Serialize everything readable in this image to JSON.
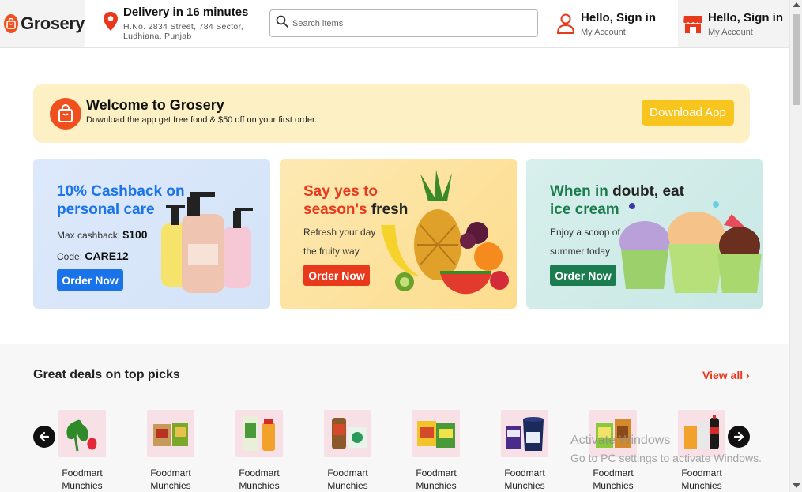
{
  "header": {
    "logo_text": "Grosery",
    "delivery_title": "Delivery in 16 minutes",
    "delivery_address": "H.No. 2834 Street, 784 Sector, Ludhiana, Punjab",
    "search_placeholder": "Search items",
    "account": {
      "title": "Hello, Sign in",
      "subtitle": "My Account"
    },
    "store_account": {
      "title": "Hello, Sign in",
      "subtitle": "My Account"
    }
  },
  "welcome": {
    "title": "Welcome to Grosery",
    "subtitle": "Download the app get free food & $50 off on your first order.",
    "button": "Download App"
  },
  "promos": [
    {
      "title_part1": "10% Cashback on",
      "title_part2": "personal care",
      "line1_label": "Max cashback: ",
      "line1_value": "$100",
      "line2_label": "Code: ",
      "line2_value": "CARE12",
      "button": "Order Now"
    },
    {
      "title_part1": "Say yes to",
      "title_part2": "season's",
      "title_part3": "fresh",
      "line1": "Refresh your day",
      "line2": "the fruity way",
      "button": "Order Now"
    },
    {
      "title_part1": "When in",
      "title_part2": "doubt, eat",
      "title_part3": "ice cream",
      "line1": "Enjoy a scoop of",
      "line2": "summer today",
      "button": "Order Now"
    }
  ],
  "deals": {
    "title": "Great deals on top picks",
    "view_all": "View all",
    "products": [
      {
        "line1": "Foodmart",
        "line2": "Munchies"
      },
      {
        "line1": "Foodmart",
        "line2": "Munchies"
      },
      {
        "line1": "Foodmart",
        "line2": "Munchies"
      },
      {
        "line1": "Foodmart",
        "line2": "Munchies"
      },
      {
        "line1": "Foodmart",
        "line2": "Munchies"
      },
      {
        "line1": "Foodmart",
        "line2": "Munchies"
      },
      {
        "line1": "Foodmart",
        "line2": "Munchies"
      },
      {
        "line1": "Foodmart",
        "line2": "Munchies"
      }
    ]
  },
  "watermark": {
    "line1": "Activate Windows",
    "line2": "Go to PC settings to activate Windows."
  },
  "colors": {
    "brand": "#f0501e",
    "accent_yellow": "#f7c51e",
    "blue": "#1a73e8",
    "red": "#e8391d",
    "green": "#1b7d4f"
  }
}
